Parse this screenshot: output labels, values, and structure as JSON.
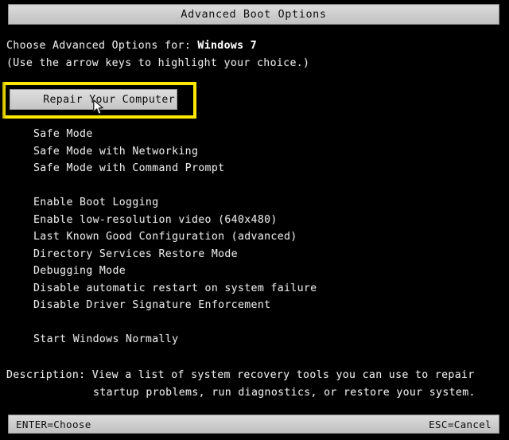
{
  "window": {
    "title": "Advanced Boot Options"
  },
  "header": {
    "prompt_prefix": "Choose Advanced Options for: ",
    "os_name": "Windows 7",
    "hint": "(Use the arrow keys to highlight your choice.)"
  },
  "selection": {
    "label": "Repair Your Computer",
    "highlight_color": "#ffe800",
    "row_background": "#d2d2d2",
    "row_text_color": "#0c0c0c",
    "cursor_icon": "mouse-pointer-icon"
  },
  "menu": {
    "items": [
      {
        "label": "Safe Mode",
        "type": "option"
      },
      {
        "label": "Safe Mode with Networking",
        "type": "option"
      },
      {
        "label": "Safe Mode with Command Prompt",
        "type": "option"
      },
      {
        "label": " ",
        "type": "spacer"
      },
      {
        "label": "Enable Boot Logging",
        "type": "option"
      },
      {
        "label": "Enable low-resolution video (640x480)",
        "type": "option"
      },
      {
        "label": "Last Known Good Configuration (advanced)",
        "type": "option"
      },
      {
        "label": "Directory Services Restore Mode",
        "type": "option"
      },
      {
        "label": "Debugging Mode",
        "type": "option"
      },
      {
        "label": "Disable automatic restart on system failure",
        "type": "option"
      },
      {
        "label": "Disable Driver Signature Enforcement",
        "type": "option"
      },
      {
        "label": " ",
        "type": "spacer"
      },
      {
        "label": "Start Windows Normally",
        "type": "option"
      }
    ]
  },
  "description": {
    "line1": "Description: View a list of system recovery tools you can use to repair",
    "line2": "startup problems, run diagnostics, or restore your system."
  },
  "status_bar": {
    "left_label": "ENTER=Choose",
    "right_label": "ESC=Cancel"
  },
  "colors": {
    "background": "#000000",
    "text": "#e6e6e6",
    "chrome": "#cfcfcf",
    "annotation": "#ffe800"
  }
}
